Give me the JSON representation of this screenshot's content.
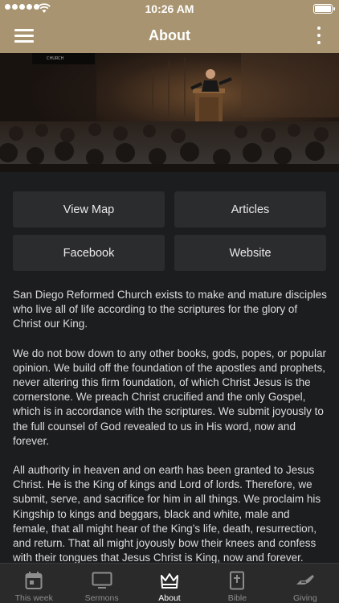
{
  "status_bar": {
    "time": "10:26 AM"
  },
  "nav": {
    "title": "About"
  },
  "hero": {
    "pulpit_sign": "CHURCH"
  },
  "buttons": [
    {
      "label": "View Map"
    },
    {
      "label": "Articles"
    },
    {
      "label": "Facebook"
    },
    {
      "label": "Website"
    }
  ],
  "about": {
    "paragraphs": [
      "San Diego Reformed Church exists to make and mature disciples who live all of life according to the scriptures for the glory of Christ our King.",
      "We do not bow down to any other books, gods, popes, or popular opinion. We build off the foundation of the apostles and prophets, never altering this firm foundation, of which Christ Jesus is the cornerstone. We preach Christ crucified and the only Gospel, which is in accordance with the scriptures. We submit joyously to the full counsel of God revealed to us in His word, now and forever.",
      "All authority in heaven and on earth has been granted to Jesus Christ. He is the King of kings and Lord of lords. Therefore, we submit, serve, and sacrifice for him in all things. We proclaim his Kingship to kings and beggars, black and white, male and female, that all might hear of the King’s life, death, resurrection, and return. That all might joyously bow their knees and confess with their tongues that Jesus Christ is King, now and forever."
    ]
  },
  "tabs": [
    {
      "label": "This week",
      "icon": "calendar-icon",
      "active": false
    },
    {
      "label": "Sermons",
      "icon": "tv-icon",
      "active": false
    },
    {
      "label": "About",
      "icon": "crown-icon",
      "active": true
    },
    {
      "label": "Bible",
      "icon": "bible-icon",
      "active": false
    },
    {
      "label": "Giving",
      "icon": "giving-hand-icon",
      "active": false
    }
  ],
  "colors": {
    "accent": "#a89470",
    "background": "#1c1d1f",
    "button": "#2b2c2e",
    "tab_bar": "#2a2a2b"
  }
}
